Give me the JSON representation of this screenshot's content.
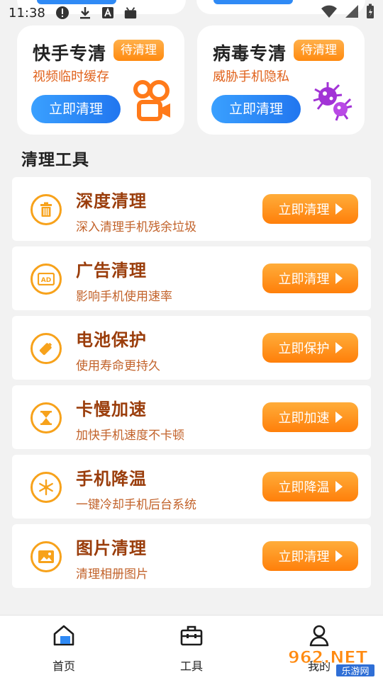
{
  "status_bar": {
    "time": "11:38"
  },
  "feature_cards": [
    {
      "title": "快手专清",
      "badge": "待清理",
      "subtitle": "视频临时缓存",
      "button": "立即清理",
      "art_icon": "kuaishou-logo-icon"
    },
    {
      "title": "病毒专清",
      "badge": "待清理",
      "subtitle": "威胁手机隐私",
      "button": "立即清理",
      "art_icon": "virus-icon"
    }
  ],
  "tools_section": {
    "title": "清理工具",
    "items": [
      {
        "name": "深度清理",
        "desc": "深入清理手机残余垃圾",
        "button": "立即清理",
        "icon": "trash-icon"
      },
      {
        "name": "广告清理",
        "desc": "影响手机使用速率",
        "button": "立即清理",
        "icon": "ad-icon"
      },
      {
        "name": "电池保护",
        "desc": "使用寿命更持久",
        "button": "立即保护",
        "icon": "battery-icon"
      },
      {
        "name": "卡慢加速",
        "desc": "加快手机速度不卡顿",
        "button": "立即加速",
        "icon": "hourglass-icon"
      },
      {
        "name": "手机降温",
        "desc": "一键冷却手机后台系统",
        "button": "立即降温",
        "icon": "snowflake-icon"
      },
      {
        "name": "图片清理",
        "desc": "清理相册图片",
        "button": "立即清理",
        "icon": "picture-icon"
      }
    ]
  },
  "bottom_nav": {
    "items": [
      {
        "label": "首页",
        "icon": "home-icon",
        "active": true
      },
      {
        "label": "工具",
        "icon": "toolbox-icon",
        "active": false
      },
      {
        "label": "我的",
        "icon": "user-icon",
        "active": false
      }
    ]
  },
  "watermark": {
    "brand": "962.NET",
    "sub": "乐游网"
  },
  "colors": {
    "accent_blue": "#2f8af5",
    "accent_orange": "#ff8a10",
    "tool_title": "#9a3d0b"
  }
}
